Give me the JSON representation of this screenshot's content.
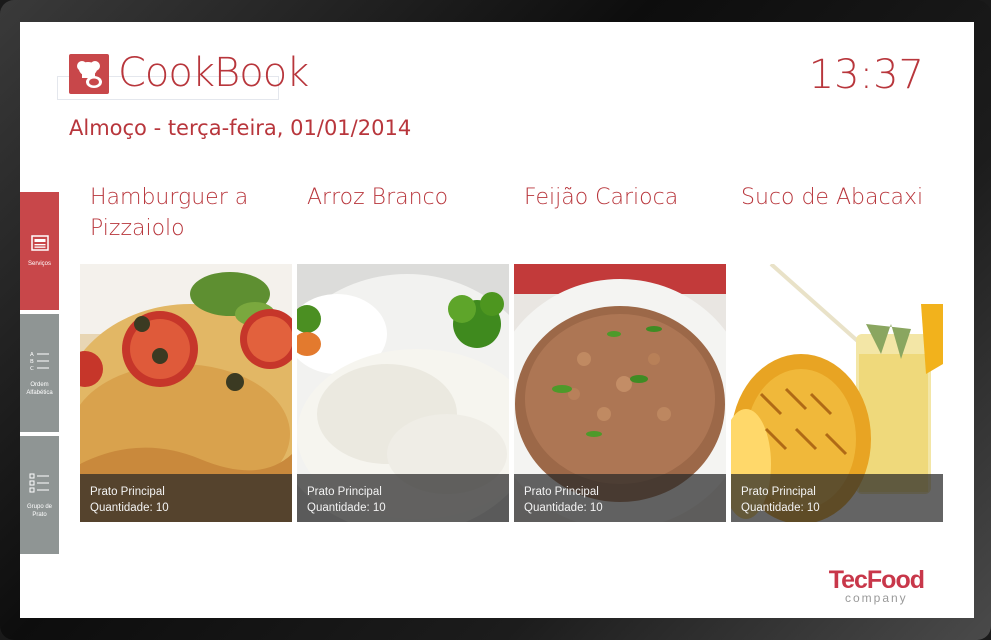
{
  "app": {
    "title": "CookBook",
    "clock": "13:37"
  },
  "header": {
    "subtitle": "Almoço - terça-feira, 01/01/2014"
  },
  "sidebar": {
    "items": [
      {
        "label": "Serviços",
        "active": true
      },
      {
        "label": "Ordem Alfabética",
        "active": false
      },
      {
        "label": "Grupo de Prato",
        "active": false
      }
    ]
  },
  "cards": [
    {
      "title": "Hamburguer a Pizzaiolo",
      "category": "Prato Principal",
      "quantity": "Quantidade: 10"
    },
    {
      "title": "Arroz Branco",
      "category": "Prato Principal",
      "quantity": "Quantidade: 10"
    },
    {
      "title": "Feijão Carioca",
      "category": "Prato Principal",
      "quantity": "Quantidade: 10"
    },
    {
      "title": "Suco de Abacaxi",
      "category": "Prato Principal",
      "quantity": "Quantidade: 10"
    }
  ],
  "footer": {
    "brand": "TecFood",
    "brand_sub": "company"
  },
  "colors": {
    "accent": "#c8474a",
    "sidebar_gray": "#8f9594"
  }
}
